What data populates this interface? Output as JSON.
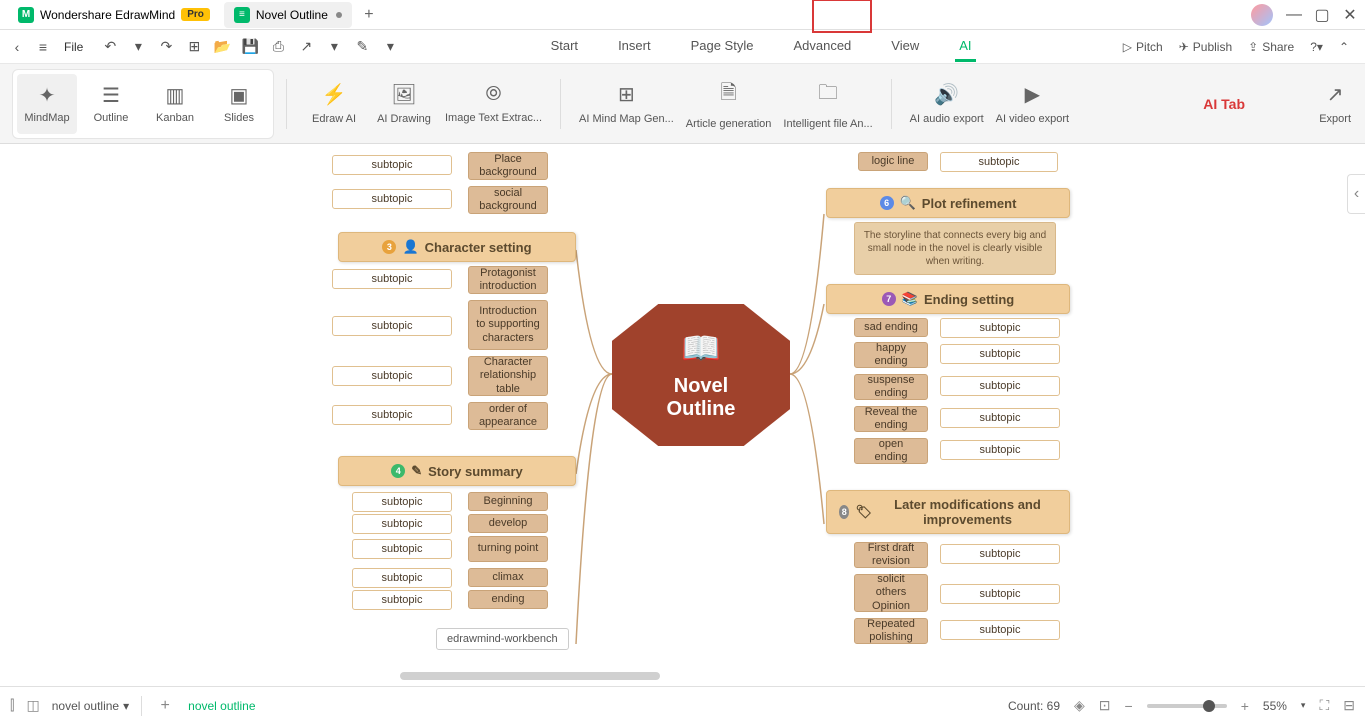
{
  "titlebar": {
    "app_name": "Wondershare EdrawMind",
    "pro_badge": "Pro",
    "doc_tab": "Novel Outline"
  },
  "menurow": {
    "file": "File",
    "items": [
      "Start",
      "Insert",
      "Page Style",
      "Advanced",
      "View",
      "AI"
    ],
    "right": {
      "pitch": "Pitch",
      "publish": "Publish",
      "share": "Share"
    }
  },
  "ribbon": {
    "views": [
      "MindMap",
      "Outline",
      "Kanban",
      "Slides"
    ],
    "ai_tools": [
      "Edraw AI",
      "AI Drawing",
      "Image Text Extrac...",
      "AI Mind Map Gen...",
      "Article generation",
      "Intelligent file An...",
      "AI audio export",
      "AI video export"
    ],
    "ai_tab_label": "AI Tab",
    "export": "Export"
  },
  "mindmap": {
    "center": "Novel\nOutline",
    "left": {
      "backgrounds": [
        {
          "item": "Place background",
          "sub": "subtopic"
        },
        {
          "item": "social background",
          "sub": "subtopic"
        }
      ],
      "character_title": "Character setting",
      "characters": [
        {
          "item": "Protagonist introduction",
          "sub": "subtopic"
        },
        {
          "item": "Introduction to supporting characters",
          "sub": "subtopic"
        },
        {
          "item": "Character relationship table",
          "sub": "subtopic"
        },
        {
          "item": "order of appearance",
          "sub": "subtopic"
        }
      ],
      "story_title": "Story summary",
      "story": [
        {
          "item": "Beginning",
          "sub": "subtopic"
        },
        {
          "item": "develop",
          "sub": "subtopic"
        },
        {
          "item": "turning point",
          "sub": "subtopic"
        },
        {
          "item": "climax",
          "sub": "subtopic"
        },
        {
          "item": "ending",
          "sub": "subtopic"
        }
      ],
      "workbench": "edrawmind-workbench"
    },
    "right": {
      "logic": {
        "item": "logic line",
        "sub": "subtopic"
      },
      "plot_title": "Plot refinement",
      "plot_desc": "The storyline that connects every big and small node in the novel is clearly visible when writing.",
      "ending_title": "Ending setting",
      "endings": [
        {
          "item": "sad ending",
          "sub": "subtopic"
        },
        {
          "item": "happy ending",
          "sub": "subtopic"
        },
        {
          "item": "suspense ending",
          "sub": "subtopic"
        },
        {
          "item": "Reveal the ending",
          "sub": "subtopic"
        },
        {
          "item": "open ending",
          "sub": "subtopic"
        }
      ],
      "later_title": "Later modifications and improvements",
      "laters": [
        {
          "item": "First draft revision",
          "sub": "subtopic"
        },
        {
          "item": "solicit others Opinion",
          "sub": "subtopic"
        },
        {
          "item": "Repeated polishing",
          "sub": "subtopic"
        }
      ]
    }
  },
  "statusbar": {
    "doc_select": "novel outline",
    "active_sheet": "novel outline",
    "count": "Count: 69",
    "zoom": "55%"
  }
}
